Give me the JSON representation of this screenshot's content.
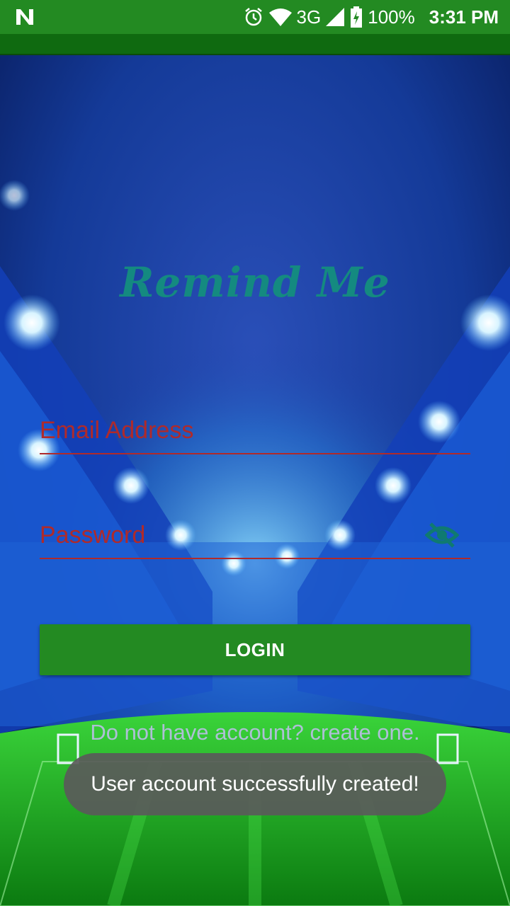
{
  "status_bar": {
    "network": "3G",
    "battery": "100%",
    "time": "3:31 PM",
    "icons": [
      "n-icon",
      "alarm-icon",
      "wifi-icon",
      "signal-icon",
      "battery-charging-icon"
    ]
  },
  "app": {
    "title": "Remind Me"
  },
  "form": {
    "email_placeholder": "Email Address",
    "email_value": "",
    "password_placeholder": "Password",
    "password_value": "",
    "login_label": "LOGIN",
    "signup_text": "Do not have account? create one."
  },
  "toast": {
    "message": "User account successfully created!"
  },
  "colors": {
    "status_bar": "#238a22",
    "accent_text": "#148a80",
    "input_text": "#b02a2a",
    "button": "#238a22"
  }
}
